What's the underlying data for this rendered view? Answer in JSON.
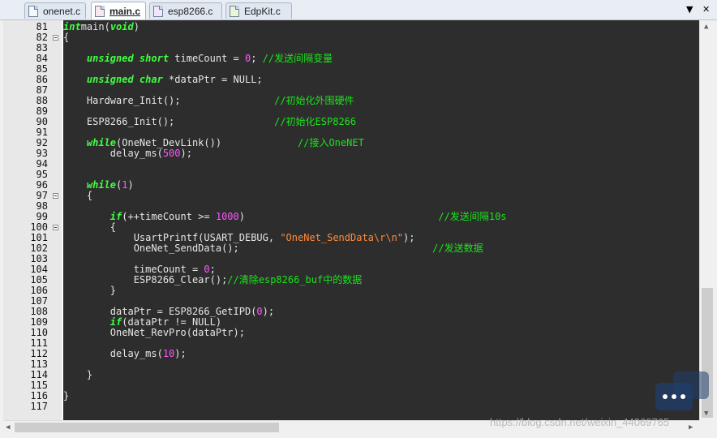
{
  "tabs": [
    {
      "label": "onenet.c",
      "active": false
    },
    {
      "label": "main.c",
      "active": true
    },
    {
      "label": "esp8266.c",
      "active": false
    },
    {
      "label": "EdpKit.c",
      "active": false
    }
  ],
  "window_controls": {
    "dropdown": "▼",
    "close": "✕"
  },
  "editor": {
    "lines": [
      {
        "no": "81",
        "fold": false,
        "tokens": [
          [
            "kw",
            "int"
          ],
          [
            "",
            "main("
          ],
          [
            "kw",
            "void"
          ],
          [
            "",
            ")"
          ]
        ]
      },
      {
        "no": "82",
        "fold": true,
        "tokens": [
          [
            "",
            "{"
          ]
        ]
      },
      {
        "no": "83",
        "fold": false,
        "tokens": []
      },
      {
        "no": "84",
        "fold": false,
        "tokens": [
          [
            "",
            "    "
          ],
          [
            "kw",
            "unsigned short"
          ],
          [
            "",
            " timeCount = "
          ],
          [
            "num",
            "0"
          ],
          [
            "",
            ";"
          ],
          [
            "cm",
            " //发送间隔变量"
          ]
        ]
      },
      {
        "no": "85",
        "fold": false,
        "tokens": []
      },
      {
        "no": "86",
        "fold": false,
        "tokens": [
          [
            "",
            "    "
          ],
          [
            "kw",
            "unsigned char"
          ],
          [
            "",
            " *dataPtr = NULL;"
          ]
        ]
      },
      {
        "no": "87",
        "fold": false,
        "tokens": []
      },
      {
        "no": "88",
        "fold": false,
        "tokens": [
          [
            "",
            "    Hardware_Init();                "
          ],
          [
            "cm",
            "//初始化外围硬件"
          ]
        ]
      },
      {
        "no": "89",
        "fold": false,
        "tokens": []
      },
      {
        "no": "90",
        "fold": false,
        "tokens": [
          [
            "",
            "    ESP8266_Init();                 "
          ],
          [
            "cm",
            "//初始化ESP8266"
          ]
        ]
      },
      {
        "no": "91",
        "fold": false,
        "tokens": []
      },
      {
        "no": "92",
        "fold": false,
        "tokens": [
          [
            "",
            "    "
          ],
          [
            "kw",
            "while"
          ],
          [
            "",
            "(OneNet_DevLink())             "
          ],
          [
            "cm",
            "//接入OneNET"
          ]
        ]
      },
      {
        "no": "93",
        "fold": false,
        "tokens": [
          [
            "",
            "        delay_ms("
          ],
          [
            "num",
            "500"
          ],
          [
            "",
            ");"
          ]
        ]
      },
      {
        "no": "94",
        "fold": false,
        "tokens": []
      },
      {
        "no": "95",
        "fold": false,
        "tokens": []
      },
      {
        "no": "96",
        "fold": false,
        "tokens": [
          [
            "",
            "    "
          ],
          [
            "kw",
            "while"
          ],
          [
            "",
            "("
          ],
          [
            "num",
            "1"
          ],
          [
            "",
            ")"
          ]
        ]
      },
      {
        "no": "97",
        "fold": true,
        "tokens": [
          [
            "",
            "    {"
          ]
        ]
      },
      {
        "no": "98",
        "fold": false,
        "tokens": []
      },
      {
        "no": "99",
        "fold": false,
        "tokens": [
          [
            "",
            "        "
          ],
          [
            "kw",
            "if"
          ],
          [
            "",
            "(++timeCount >= "
          ],
          [
            "num",
            "1000"
          ],
          [
            "",
            ")                                 "
          ],
          [
            "cm",
            "//发送间隔10s"
          ]
        ]
      },
      {
        "no": "100",
        "fold": true,
        "tokens": [
          [
            "",
            "        {"
          ]
        ]
      },
      {
        "no": "101",
        "fold": false,
        "tokens": [
          [
            "",
            "            UsartPrintf(USART_DEBUG, "
          ],
          [
            "str",
            "\"OneNet_SendData\\r\\n\""
          ],
          [
            "",
            ");"
          ]
        ]
      },
      {
        "no": "102",
        "fold": false,
        "tokens": [
          [
            "",
            "            OneNet_SendData();                                 "
          ],
          [
            "cm",
            "//发送数据"
          ]
        ]
      },
      {
        "no": "103",
        "fold": false,
        "tokens": []
      },
      {
        "no": "104",
        "fold": false,
        "tokens": [
          [
            "",
            "            timeCount = "
          ],
          [
            "num",
            "0"
          ],
          [
            "",
            ";"
          ]
        ]
      },
      {
        "no": "105",
        "fold": false,
        "tokens": [
          [
            "",
            "            ESP8266_Clear();"
          ],
          [
            "cm",
            "//清除esp8266_buf中的数据"
          ]
        ]
      },
      {
        "no": "106",
        "fold": false,
        "tokens": [
          [
            "",
            "        }"
          ]
        ]
      },
      {
        "no": "107",
        "fold": false,
        "tokens": []
      },
      {
        "no": "108",
        "fold": false,
        "tokens": [
          [
            "",
            "        dataPtr = ESP8266_GetIPD("
          ],
          [
            "num",
            "0"
          ],
          [
            "",
            ");"
          ]
        ]
      },
      {
        "no": "109",
        "fold": false,
        "tokens": [
          [
            "",
            "        "
          ],
          [
            "kw",
            "if"
          ],
          [
            "",
            "(dataPtr != NULL)"
          ]
        ]
      },
      {
        "no": "110",
        "fold": false,
        "tokens": [
          [
            "",
            "        OneNet_RevPro(dataPtr);"
          ]
        ]
      },
      {
        "no": "111",
        "fold": false,
        "tokens": []
      },
      {
        "no": "112",
        "fold": false,
        "tokens": [
          [
            "",
            "        delay_ms("
          ],
          [
            "num",
            "10"
          ],
          [
            "",
            ");"
          ]
        ]
      },
      {
        "no": "113",
        "fold": false,
        "tokens": []
      },
      {
        "no": "114",
        "fold": false,
        "tokens": [
          [
            "",
            "    }"
          ]
        ]
      },
      {
        "no": "115",
        "fold": false,
        "tokens": []
      },
      {
        "no": "116",
        "fold": false,
        "tokens": [
          [
            "",
            "}"
          ]
        ]
      },
      {
        "no": "117",
        "fold": false,
        "tokens": []
      }
    ]
  },
  "watermark": {
    "text": "https://blog.csdn.net/weixin_44069765"
  }
}
